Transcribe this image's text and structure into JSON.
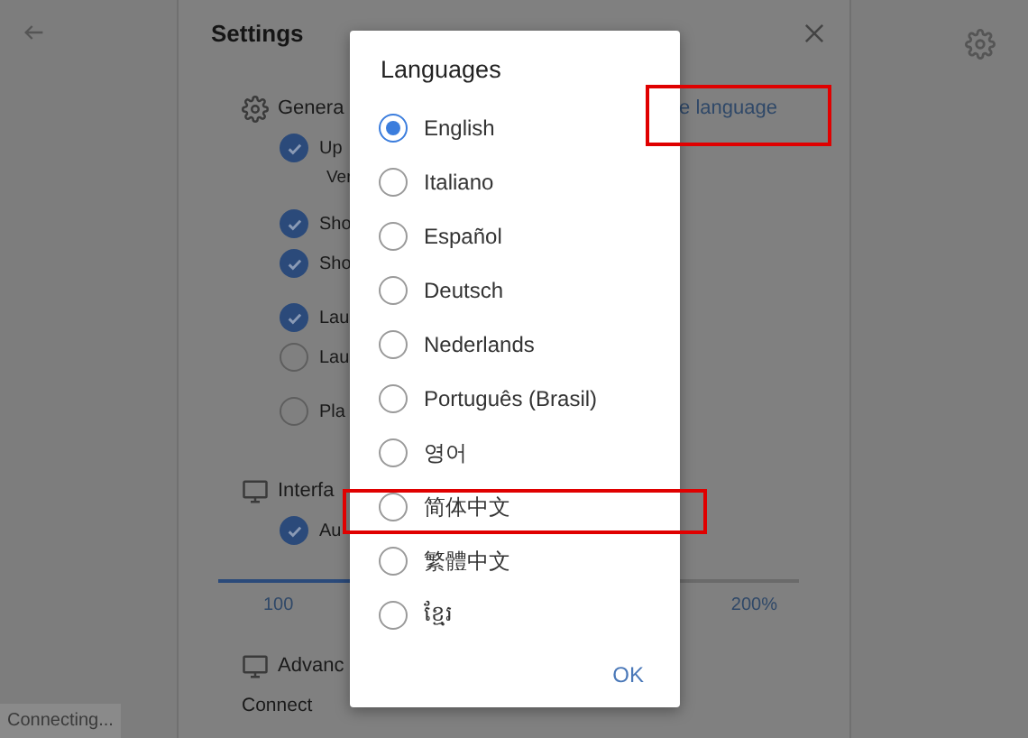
{
  "settings": {
    "title": "Settings",
    "sections": [
      {
        "kind": "gear",
        "title": "Genera",
        "link": "e language",
        "groups": [
          [
            {
              "label": "Up",
              "checked": true,
              "note": "Ver"
            }
          ],
          [
            {
              "label": "Sho",
              "checked": true
            },
            {
              "label": "Sho",
              "checked": true
            }
          ],
          [
            {
              "label": "Lau",
              "checked": true
            },
            {
              "label": "Lau",
              "checked": false
            }
          ],
          [
            {
              "label": "Pla",
              "checked": false
            }
          ]
        ]
      },
      {
        "kind": "monitor",
        "title": "Interfa",
        "groups": [
          [
            {
              "label": "Au",
              "checked": true
            }
          ]
        ],
        "slider": {
          "level": 0.78,
          "min_label": "100",
          "max_label": "200%"
        }
      },
      {
        "kind": "monitor",
        "title": "Advanc",
        "text": "Connect"
      }
    ]
  },
  "dialog": {
    "title": "Languages",
    "options": [
      {
        "label": "English",
        "selected": true
      },
      {
        "label": "Italiano",
        "selected": false
      },
      {
        "label": "Español",
        "selected": false
      },
      {
        "label": "Deutsch",
        "selected": false
      },
      {
        "label": "Nederlands",
        "selected": false
      },
      {
        "label": "Português (Brasil)",
        "selected": false
      },
      {
        "label": "영어",
        "selected": false
      },
      {
        "label": "简体中文",
        "selected": false
      },
      {
        "label": "繁體中文",
        "selected": false
      },
      {
        "label": "ខ្មែរ",
        "selected": false
      }
    ],
    "button": "OK"
  },
  "status": "Connecting..."
}
